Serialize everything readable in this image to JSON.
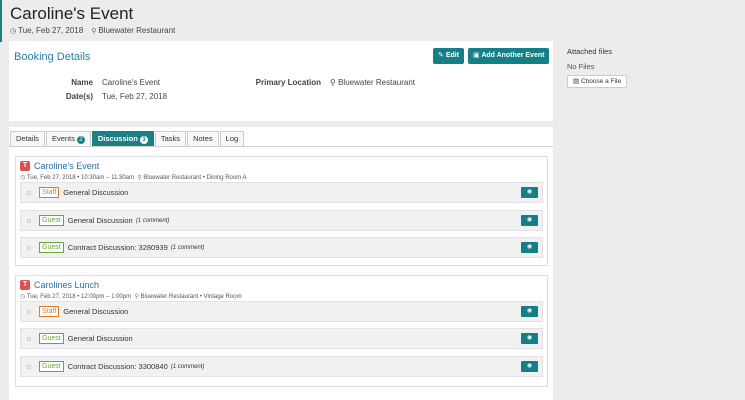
{
  "header": {
    "title": "Caroline's Event",
    "date": "Tue, Feb 27, 2018",
    "location": "Bluewater Restaurant"
  },
  "booking": {
    "title": "Booking Details",
    "edit_label": "Edit",
    "add_event_label": "Add Another Event",
    "name_label": "Name",
    "name_value": "Caroline's Event",
    "dates_label": "Date(s)",
    "dates_value": "Tue, Feb 27, 2018",
    "primary_location_label": "Primary Location",
    "primary_location_value": "Bluewater Restaurant"
  },
  "attachments": {
    "title": "Attached files",
    "empty_text": "No Files",
    "choose_label": "Choose a File"
  },
  "tabs": [
    {
      "label": "Details",
      "badge": ""
    },
    {
      "label": "Events",
      "badge": "2"
    },
    {
      "label": "Discussion",
      "badge": "3",
      "active": true
    },
    {
      "label": "Tasks",
      "badge": ""
    },
    {
      "label": "Notes",
      "badge": ""
    },
    {
      "label": "Log",
      "badge": ""
    }
  ],
  "events": [
    {
      "title": "Caroline's Event",
      "when": "Tue, Feb 27, 2018 • 10:30am – 11:30am",
      "where": "Bluewater Restaurant • Dining Room A",
      "discussions": [
        {
          "tag": "Staff",
          "title": "General Discussion",
          "note": ""
        },
        {
          "tag": "Guest",
          "title": "General Discussion",
          "note": "(1 comment)"
        },
        {
          "tag": "Guest",
          "title": "Contract Discussion: 3280939",
          "note": "(1 comment)"
        }
      ]
    },
    {
      "title": "Carolines Lunch",
      "when": "Tue, Feb 27, 2018 • 12:00pm – 1:00pm",
      "where": "Bluewater Restaurant • Vintage Room",
      "discussions": [
        {
          "tag": "Staff",
          "title": "General Discussion",
          "note": ""
        },
        {
          "tag": "Guest",
          "title": "General Discussion",
          "note": ""
        },
        {
          "tag": "Guest",
          "title": "Contract Discussion: 3300840",
          "note": "(1 comment)"
        }
      ]
    }
  ],
  "icons": {
    "clock": "clock-icon",
    "pin": "map-pin-icon",
    "eye": "eye-icon"
  },
  "colors": {
    "accent": "#1d7f86",
    "link": "#2a6ea5",
    "staff": "#e07b2a",
    "guest": "#6aa63a",
    "event_type": "#d9534f"
  }
}
